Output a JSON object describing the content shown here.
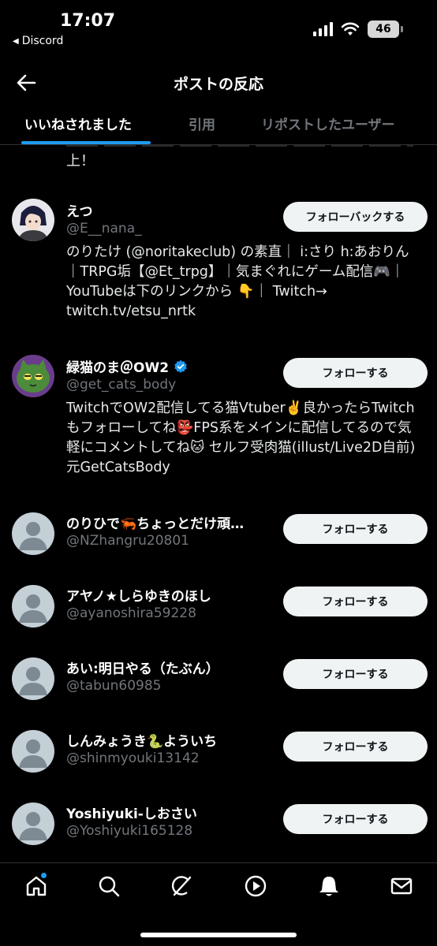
{
  "status_bar": {
    "time": "17:07",
    "back_app": "Discord",
    "battery": "46"
  },
  "header": {
    "title": "ポストの反応"
  },
  "tabs": [
    {
      "label": "いいねされました",
      "active": true
    },
    {
      "label": "引用",
      "active": false
    },
    {
      "label": "リポストしたユーザー",
      "active": false
    }
  ],
  "partial_text": "上！",
  "users": [
    {
      "name": "えつ",
      "handle": "@E__nana_",
      "verified": false,
      "button": "フォローバックする",
      "bio": "のりたけ (@noritakeclub) の素直｜ i:さり h:あおりん｜TRPG垢【@Et_trpg】｜気まぐれにゲーム配信🎮｜YouTubeは下のリンクから 👇｜ Twitch→ twitch.tv/etsu_nrtk"
    },
    {
      "name": "緑猫のま＠OW2",
      "handle": "@get_cats_body",
      "verified": true,
      "button": "フォローする",
      "bio": "TwitchでOW2配信してる猫Vtuber✌️良かったらTwitchもフォローしてね👺FPS系をメインに配信してるので気軽にコメントしてね🐱 セルフ受肉猫(illust/Live2D自前) 元GetCatsBody"
    },
    {
      "name": "のりひで🦐ちょっとだけ頑…",
      "handle": "@NZhangru20801",
      "verified": false,
      "button": "フォローする",
      "bio": ""
    },
    {
      "name": "アヤノ★しらゆきのほし",
      "handle": "@ayanoshira59228",
      "verified": false,
      "button": "フォローする",
      "bio": ""
    },
    {
      "name": "あい:明日やる（たぶん）",
      "handle": "@tabun60985",
      "verified": false,
      "button": "フォローする",
      "bio": ""
    },
    {
      "name": "しんみょうき🐍よういち",
      "handle": "@shinmyouki13142",
      "verified": false,
      "button": "フォローする",
      "bio": ""
    },
    {
      "name": "Yoshiyuki-しおさい",
      "handle": "@Yoshiyuki165128",
      "verified": false,
      "button": "フォローする",
      "bio": ""
    }
  ],
  "bottom_nav": [
    {
      "icon": "home-icon"
    },
    {
      "icon": "search-icon"
    },
    {
      "icon": "grok-icon"
    },
    {
      "icon": "video-play-icon"
    },
    {
      "icon": "notifications-bell-icon"
    },
    {
      "icon": "messages-envelope-icon"
    }
  ],
  "colors": {
    "background": "#000000",
    "accent": "#1d9bf0",
    "secondary_text": "#71767b",
    "button_bg": "#eff3f4"
  }
}
